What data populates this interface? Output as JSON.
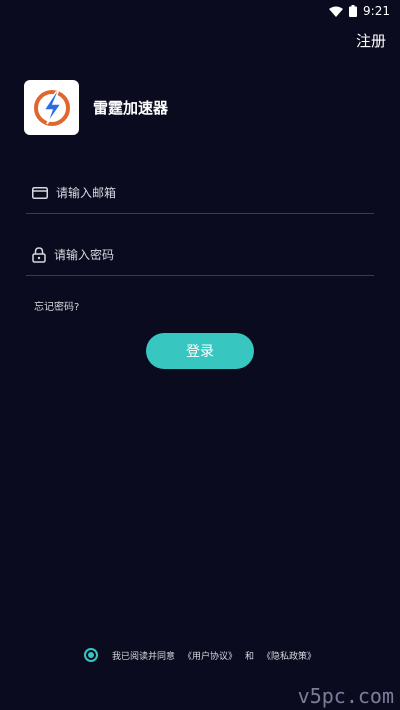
{
  "status_bar": {
    "time": "9:21",
    "wifi_icon": "wifi-icon",
    "battery_icon": "battery-icon"
  },
  "header": {
    "register_label": "注册"
  },
  "brand": {
    "app_name": "雷霆加速器",
    "logo_icon": "lightning-logo-icon"
  },
  "form": {
    "email_placeholder": "请输入邮箱",
    "email_icon": "card-icon",
    "password_placeholder": "请输入密码",
    "password_icon": "lock-icon",
    "forgot_label": "忘记密码?",
    "login_label": "登录"
  },
  "agreement": {
    "prefix": "我已阅读并同意",
    "user_agreement": "《用户协议》",
    "and": "和",
    "privacy_policy": "《隐私政策》",
    "checked": true
  },
  "watermark": "v5pc.com",
  "colors": {
    "background": "#0b0b1f",
    "accent": "#37c6c0",
    "logo_orange": "#e0662e",
    "logo_blue": "#2c6de6"
  }
}
